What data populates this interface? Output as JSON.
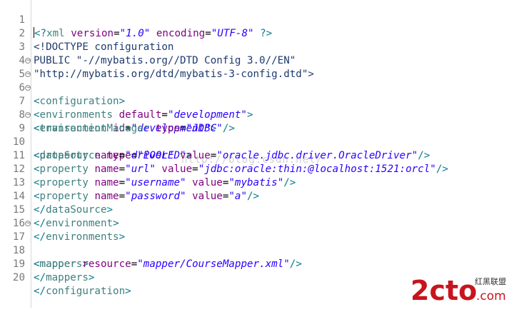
{
  "editor": {
    "lines": [
      {
        "no": "1",
        "fold": false
      },
      {
        "no": "2",
        "fold": false
      },
      {
        "no": "3",
        "fold": false
      },
      {
        "no": "4",
        "fold": false
      },
      {
        "no": "5",
        "fold": true
      },
      {
        "no": "6",
        "fold": true
      },
      {
        "no": "7",
        "fold": true
      },
      {
        "no": "8",
        "fold": false
      },
      {
        "no": "9",
        "fold": true
      },
      {
        "no": "10",
        "fold": false
      },
      {
        "no": "11",
        "fold": false
      },
      {
        "no": "12",
        "fold": false
      },
      {
        "no": "13",
        "fold": false
      },
      {
        "no": "14",
        "fold": false
      },
      {
        "no": "15",
        "fold": false
      },
      {
        "no": "16",
        "fold": false
      },
      {
        "no": "17",
        "fold": true
      },
      {
        "no": "18",
        "fold": false
      },
      {
        "no": "19",
        "fold": false
      },
      {
        "no": "20",
        "fold": false
      }
    ],
    "code": {
      "l1": {
        "open": "<?",
        "name": "xml",
        "a1": "version",
        "v1": "\"1.0\"",
        "a2": "encoding",
        "v2": "\"UTF-8\"",
        "close": "?>"
      },
      "l2": {
        "text": "<!DOCTYPE configuration"
      },
      "l3": {
        "text": "PUBLIC \"-//mybatis.org//DTD Config 3.0//EN\""
      },
      "l4": {
        "text": "\"http://mybatis.org/dtd/mybatis-3-config.dtd\">"
      },
      "l5": {
        "name": "configuration"
      },
      "l6": {
        "name": "environments",
        "a1": "default",
        "v1": "\"development\""
      },
      "l7": {
        "name": "environment",
        "a1": "id",
        "v1": "\"development\""
      },
      "l8": {
        "name": "transactionManager",
        "a1": "type",
        "v1": "\"JDBC\""
      },
      "l9": {
        "name": "dataSource",
        "a1": "type",
        "v1": "\"POOLED\""
      },
      "l10": {
        "name": "property",
        "a1": "name",
        "v1": "\"driver\"",
        "a2": "value",
        "v2": "\"oracle.jdbc.driver.OracleDriver\""
      },
      "l11": {
        "name": "property",
        "a1": "name",
        "v1": "\"url\"",
        "a2": "value",
        "v2": "\"jdbc:oracle:thin:@localhost:1521:orcl\""
      },
      "l12": {
        "name": "property",
        "a1": "name",
        "v1": "\"username\"",
        "a2": "value",
        "v2": "\"mybatis\""
      },
      "l13": {
        "name": "property",
        "a1": "name",
        "v1": "\"password\"",
        "a2": "value",
        "v2": "\"a\""
      },
      "l14": {
        "name": "dataSource"
      },
      "l15": {
        "name": "environment"
      },
      "l16": {
        "name": "environments"
      },
      "l17": {
        "name": "mappers"
      },
      "l18": {
        "name": "mapper",
        "a1": "resource",
        "v1": "\"mapper/CourseMapper.xml\""
      },
      "l19": {
        "name": "mappers"
      },
      "l20": {
        "name": "configuration"
      }
    }
  },
  "watermark": "http://blog.csdn.net/",
  "logo": {
    "brand": "2cto",
    "suffix": ".com",
    "tagline": "红黑联盟"
  },
  "colors": {
    "tag": "#3f7f7f",
    "attr": "#7f007f",
    "value": "#2a00ff",
    "logo_red": "#c8141e"
  }
}
